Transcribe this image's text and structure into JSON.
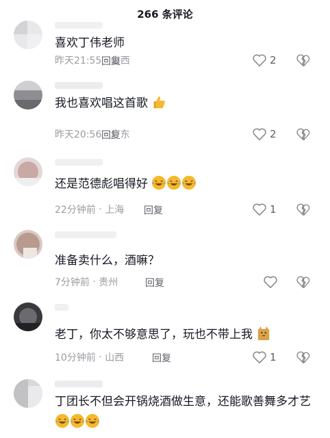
{
  "header": {
    "title": "266 条评论"
  },
  "comments": [
    {
      "text": "喜欢丁伟老师",
      "time": "昨天21:55",
      "location": "山西",
      "reply": "回复",
      "likes": "2"
    },
    {
      "text": "我也喜欢唱这首歌",
      "time": "昨天20:56",
      "location": "广东",
      "reply": "回复",
      "likes": "2"
    },
    {
      "text": "还是范德彪唱得好",
      "time": "22分钟前",
      "location": "上海",
      "reply": "回复",
      "likes": "1"
    },
    {
      "text": "准备卖什么，酒嘛？",
      "time": "7分钟前",
      "location": "贵州",
      "reply": "回复",
      "likes": ""
    },
    {
      "text": "老丁，你太不够意思了，玩也不带上我",
      "time": "10分钟前",
      "location": "山西",
      "reply": "回复",
      "likes": "1"
    },
    {
      "text": "丁团长不但会开锅烧酒做生意，还能歌善舞多才艺",
      "time": "",
      "location": "",
      "reply": "",
      "likes": ""
    }
  ],
  "icons": {
    "like": "heart-outline-icon",
    "dislike": "broken-heart-icon",
    "emoji_thumbs": "thumbs-up-emoji",
    "emoji_laugh": "laughing-tears-emoji",
    "emoji_cat": "cat-emoji"
  },
  "colors": {
    "meta": "#9a9ba1",
    "text": "#161823",
    "emoji": "#f6b82c"
  }
}
